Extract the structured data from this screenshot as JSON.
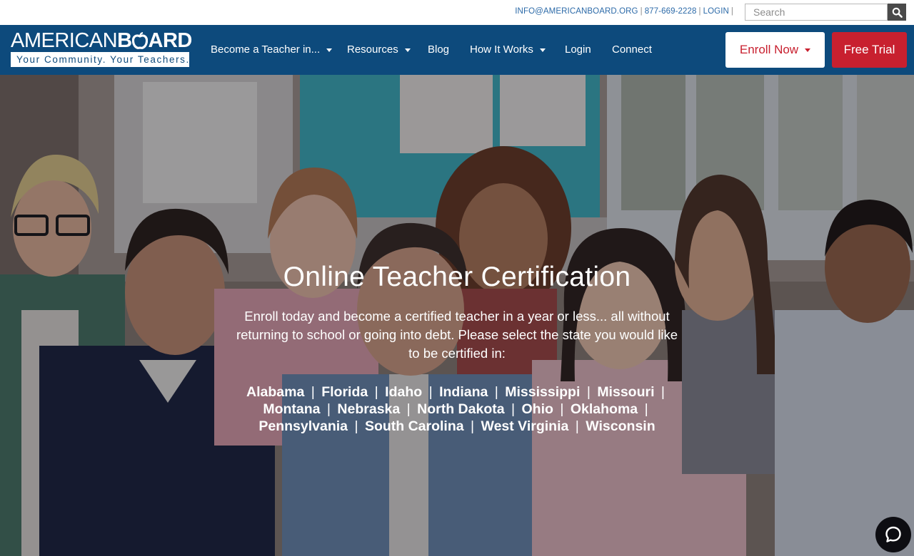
{
  "utility": {
    "email": "INFO@AMERICANBOARD.ORG",
    "phone": "877-669-2228",
    "login": "LOGIN",
    "separator": "|",
    "search_placeholder": "Search",
    "search_icon": "search-icon"
  },
  "logo": {
    "word_part1": "AMERICAN",
    "word_part2": "B",
    "word_part3": "ARD",
    "tagline": "Your Community. Your Teachers."
  },
  "nav": {
    "items": [
      {
        "label": "Become a Teacher in...",
        "dropdown": true
      },
      {
        "label": "Resources",
        "dropdown": true
      },
      {
        "label": "Blog",
        "dropdown": false
      },
      {
        "label": "How It Works",
        "dropdown": true
      },
      {
        "label": "Login",
        "dropdown": false
      },
      {
        "label": "Connect",
        "dropdown": false
      }
    ],
    "enroll_label": "Enroll Now",
    "trial_label": "Free Trial"
  },
  "hero": {
    "title": "Online Teacher Certification",
    "lead": "Enroll today and become a certified teacher in a year or less... all without returning to school or going into debt. Please select the state you would like to be certified in:",
    "states": [
      "Alabama",
      "Florida",
      "Idaho",
      "Indiana",
      "Mississippi",
      "Missouri",
      "Montana",
      "Nebraska",
      "North Dakota",
      "Ohio",
      "Oklahoma",
      "Pennsylvania",
      "South Carolina",
      "West Virginia",
      "Wisconsin"
    ],
    "state_separator": "|"
  },
  "chat": {
    "icon": "chat-bubble-icon"
  },
  "colors": {
    "nav_bg": "#0d4a7c",
    "accent_red": "#c8202f",
    "link_blue": "#2c6aa8",
    "white": "#ffffff"
  }
}
